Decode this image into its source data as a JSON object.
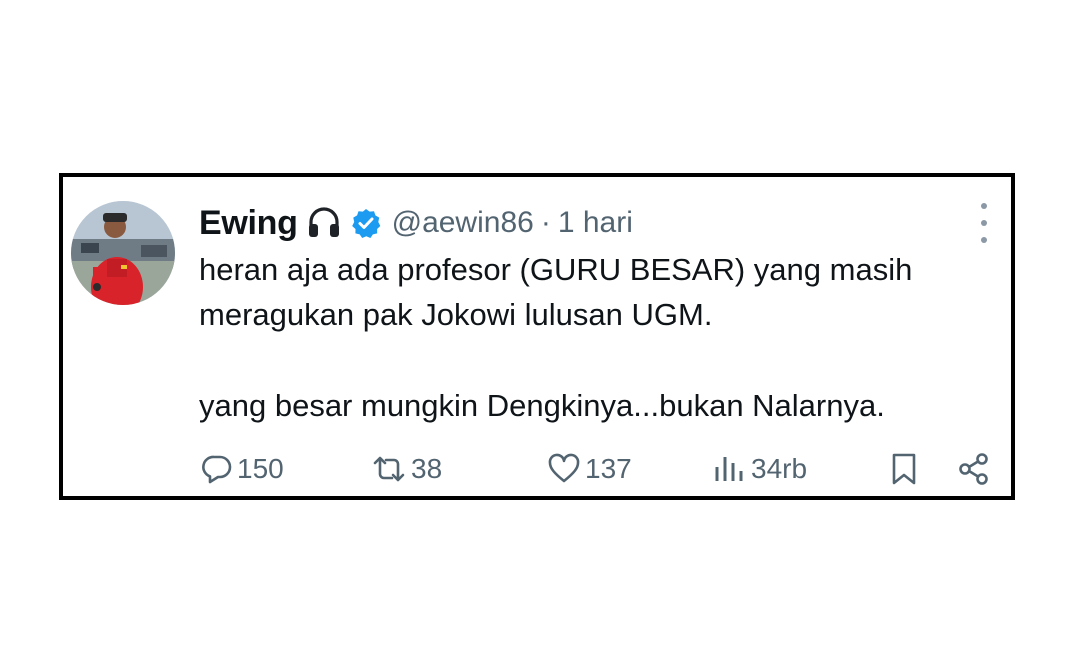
{
  "tweet": {
    "author": {
      "display_name": "Ewing",
      "name_emoji_icon": "headphones-icon",
      "verified_icon": "verified-badge-icon",
      "handle": "@aewin86",
      "separator": "·",
      "timestamp": "1 hari",
      "avatar_icon": "profile-photo"
    },
    "text": {
      "line1": "heran aja ada profesor (GURU BESAR) yang masih",
      "line2": "meragukan pak Jokowi lulusan UGM.",
      "line3": "yang besar mungkin Dengkinya...bukan Nalarnya."
    },
    "actions": {
      "replies": "150",
      "reposts": "38",
      "likes": "137",
      "views": "34rb"
    },
    "menu_icon": "more-vertical-icon",
    "colors": {
      "text": "#0f1419",
      "secondary": "#536471",
      "verified": "#1d9bf0",
      "border": "#000000"
    }
  }
}
